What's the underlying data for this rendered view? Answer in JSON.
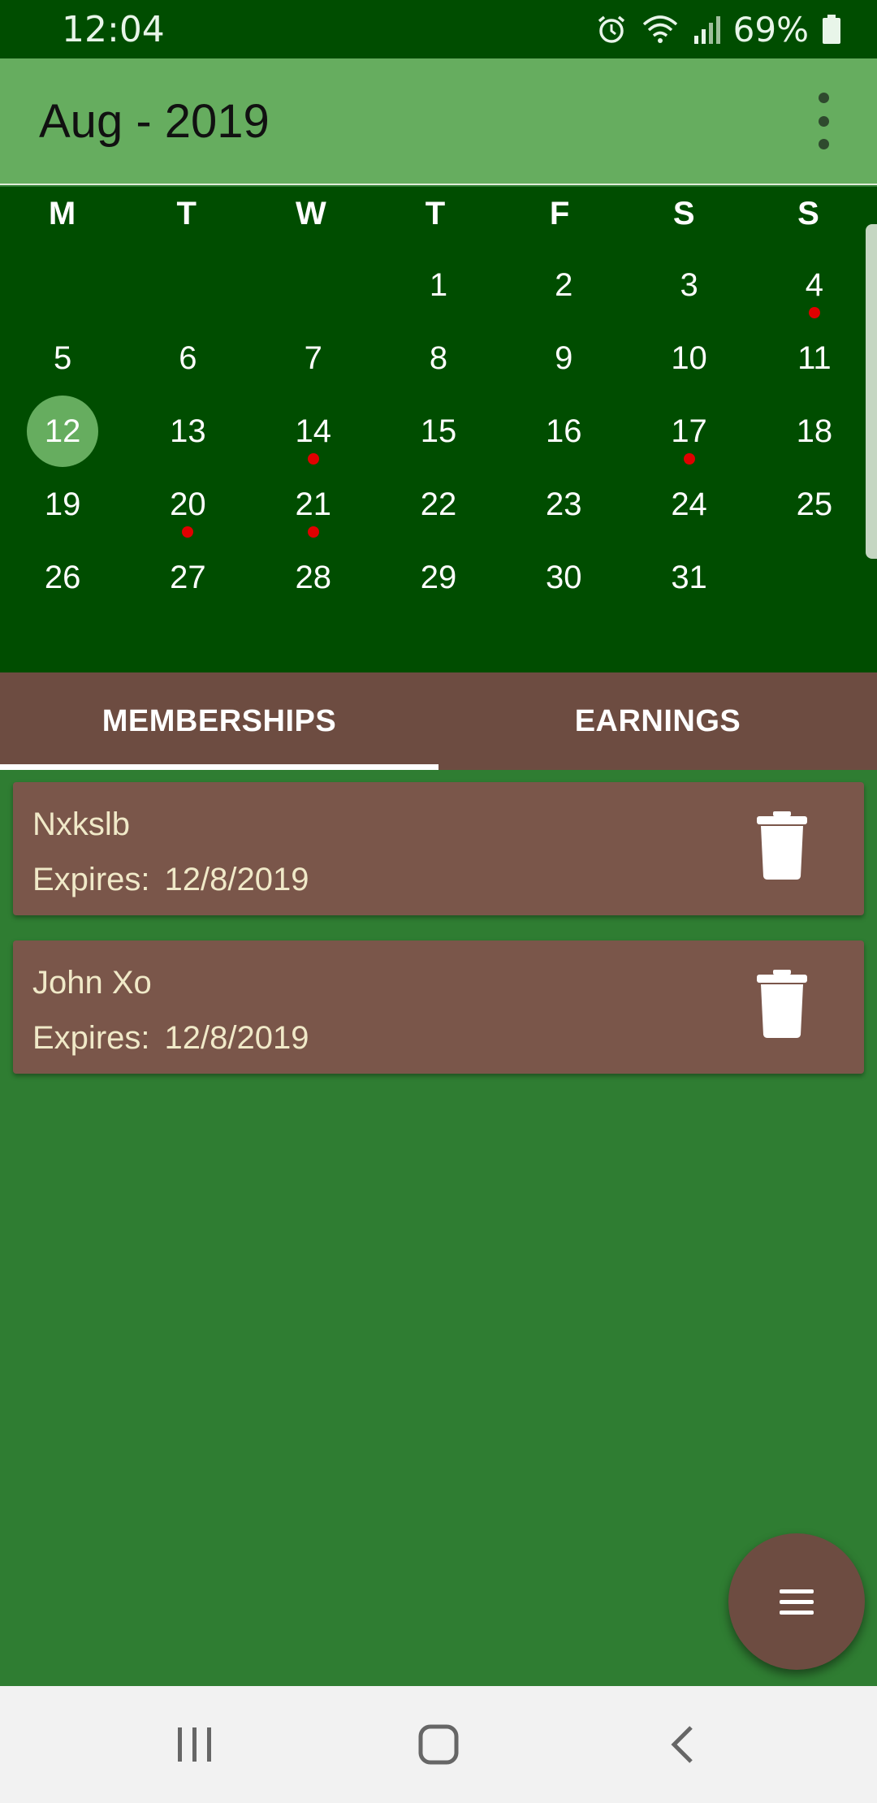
{
  "status_bar": {
    "time": "12:04",
    "battery_percent": "69%",
    "icons": [
      "alarm-icon",
      "wifi-icon",
      "signal-icon",
      "battery-icon"
    ]
  },
  "app_bar": {
    "title": "Aug - 2019",
    "menu_icon": "overflow-menu-icon"
  },
  "calendar": {
    "weekdays": [
      "M",
      "T",
      "W",
      "T",
      "F",
      "S",
      "S"
    ],
    "leading_blanks": 3,
    "days": [
      {
        "label": "1"
      },
      {
        "label": "2"
      },
      {
        "label": "3"
      },
      {
        "label": "4",
        "event": true
      },
      {
        "label": "5"
      },
      {
        "label": "6"
      },
      {
        "label": "7"
      },
      {
        "label": "8"
      },
      {
        "label": "9"
      },
      {
        "label": "10"
      },
      {
        "label": "11"
      },
      {
        "label": "12",
        "today": true
      },
      {
        "label": "13"
      },
      {
        "label": "14",
        "event": true
      },
      {
        "label": "15"
      },
      {
        "label": "16"
      },
      {
        "label": "17",
        "event": true
      },
      {
        "label": "18"
      },
      {
        "label": "19"
      },
      {
        "label": "20",
        "event": true
      },
      {
        "label": "21",
        "event": true
      },
      {
        "label": "22"
      },
      {
        "label": "23"
      },
      {
        "label": "24"
      },
      {
        "label": "25"
      },
      {
        "label": "26"
      },
      {
        "label": "27"
      },
      {
        "label": "28"
      },
      {
        "label": "29"
      },
      {
        "label": "30"
      },
      {
        "label": "31"
      }
    ],
    "event_dot_color": "#e00000",
    "today_color": "#66ad5f"
  },
  "tabs": [
    {
      "label": "MEMBERSHIPS",
      "active": true
    },
    {
      "label": "EARNINGS",
      "active": false
    }
  ],
  "memberships": [
    {
      "name": "Nxkslb",
      "expires_label": "Expires:",
      "expires_date": "12/8/2019",
      "delete_icon": "trash-icon"
    },
    {
      "name": "John Xo",
      "expires_label": "Expires:",
      "expires_date": "12/8/2019",
      "delete_icon": "trash-icon"
    }
  ],
  "fab": {
    "icon": "menu-icon"
  },
  "nav_bar": {
    "icons": [
      "recent-apps-icon",
      "home-icon",
      "back-icon"
    ]
  },
  "colors": {
    "status_bar": "#004d00",
    "app_bar": "#66ad5f",
    "calendar_bg": "#004d00",
    "tabs_bg": "#6d4c41",
    "content_bg": "#2f7d32",
    "card_bg": "#7a564a",
    "card_text": "#f0e9c8"
  }
}
